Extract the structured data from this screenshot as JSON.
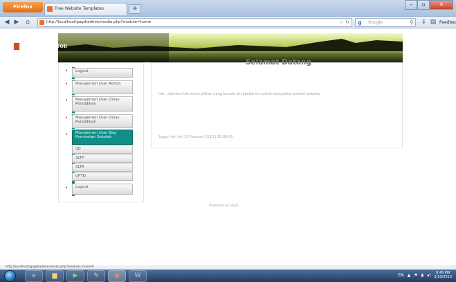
{
  "browser": {
    "app_button": "Firefox",
    "tab_title": "Free Website Templates",
    "new_tab_label": "+",
    "url": "http://localhost/gagd/admin/media.php?module=home",
    "search_placeholder": "Google",
    "feedback_label": "Feedback"
  },
  "header": {
    "brand": "ADMINISTRATOR"
  },
  "sidebar": {
    "items": [
      {
        "label": "Logout"
      },
      {
        "label": "Manajemen User Admin"
      },
      {
        "label": "Manajemen User Dinas Pendidikan"
      },
      {
        "label": "Manajemen User Dinas Pendidikan"
      },
      {
        "label": "Manajemen User Bag Peminatan Sekolah"
      },
      {
        "label": "SD"
      },
      {
        "label": "SLTP"
      },
      {
        "label": "SLTA"
      },
      {
        "label": "UPTD"
      },
      {
        "label": "Logout"
      }
    ]
  },
  "main": {
    "title": "Selamat Datang",
    "welcome_text": "Hai , silahkan klik menu pilihan yang berada di sebelah kiri untuk mengelola content website",
    "login_info": "Login Hari ini: 10 Februari 2013 | 20:00:00"
  },
  "footer": {
    "text": "Powered by GGD"
  },
  "statusbar": {
    "text": "http://localhost/gagd/admin/media.php?module=home#"
  },
  "taskbar": {
    "language": "EN",
    "time": "8:45 PM",
    "date": "2/10/2013"
  },
  "colors": {
    "accent": "#0f8f88",
    "header_bg": "#111111"
  }
}
